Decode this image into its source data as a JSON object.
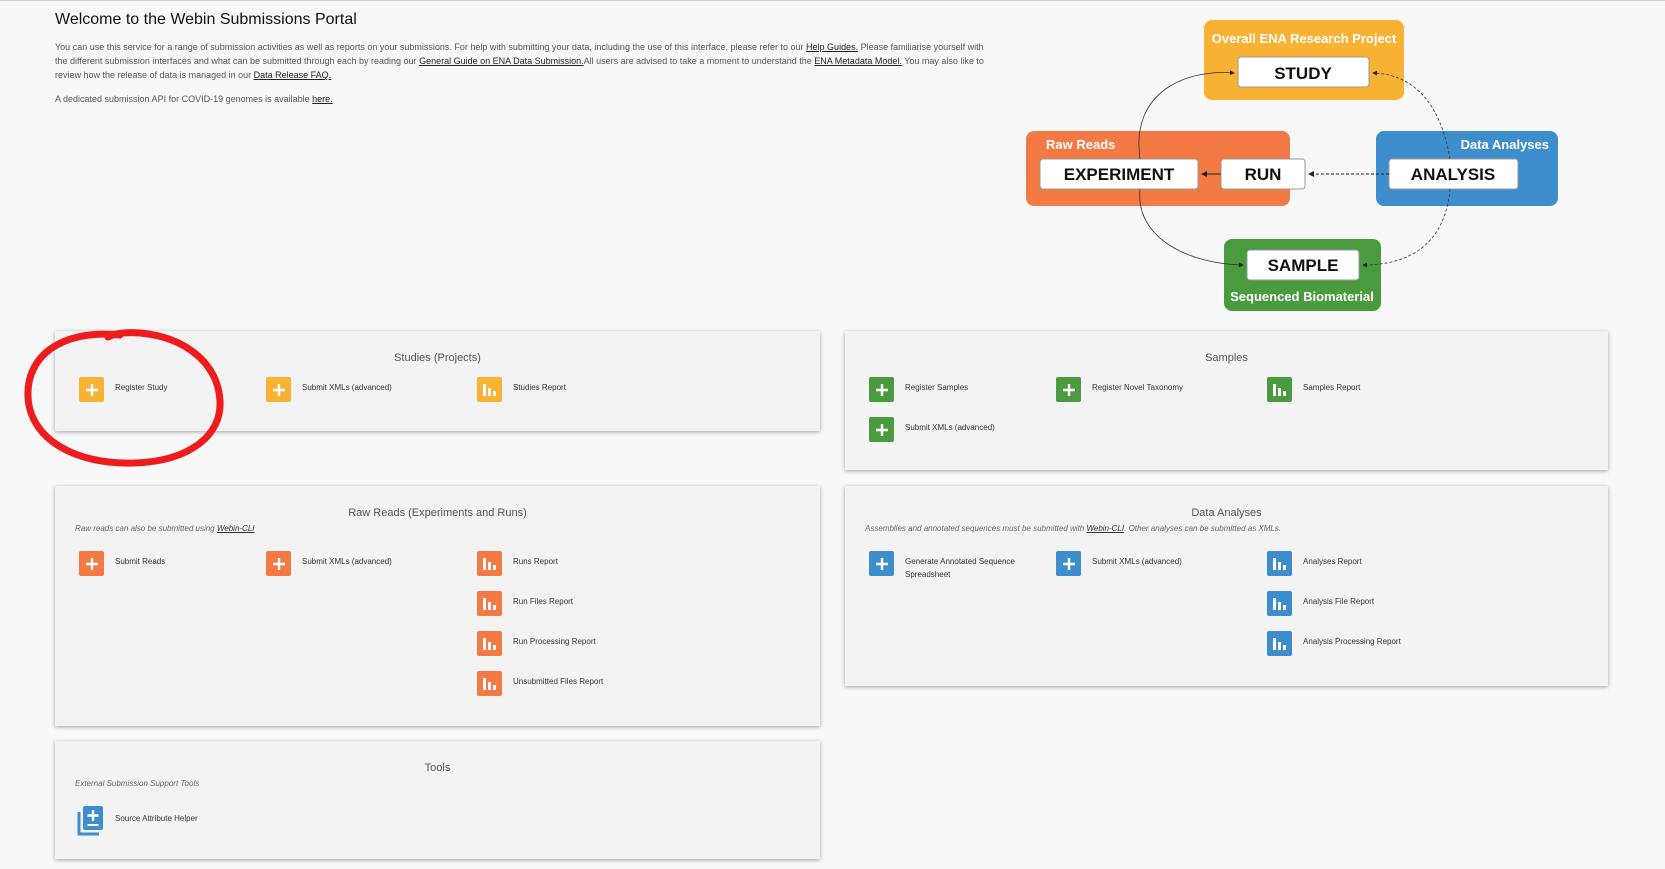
{
  "intro": {
    "title": "Welcome to the Webin Submissions Portal",
    "p1_part1": "You can use this service for a range of submission activities as well as reports on your submissions. For help with submitting your data, including the use of this interface, please refer to our ",
    "help_link": "Help Guides.",
    "p1_part2": " Please familiarise yourself with the different submission interfaces and what can be submitted through each by reading our ",
    "guide_link": "General Guide on ENA Data Submission.",
    "p1_part3": "All users are advised to take a moment to understand the ",
    "metadata_link": "ENA Metadata Model.",
    "p1_part4": " You may also like to review how the release of data is managed in our ",
    "faq_link": "Data Release FAQ.",
    "covid_text": "A dedicated submission API for COVID-19 genomes is available ",
    "covid_link": "here."
  },
  "diagram": {
    "project_title": "Overall ENA Research Project",
    "study": "STUDY",
    "raw_reads_title": "Raw Reads",
    "experiment": "EXPERIMENT",
    "run": "RUN",
    "analyses_title": "Data Analyses",
    "analysis": "ANALYSIS",
    "sample": "SAMPLE",
    "sample_title": "Sequenced Biomaterial",
    "colors": {
      "yellow": "#f9b233",
      "orange": "#f47a45",
      "blue": "#3e8ecd",
      "green": "#4a9b3f"
    }
  },
  "studies": {
    "title": "Studies (Projects)",
    "items": [
      "Register Study",
      "Submit XMLs (advanced)",
      "Studies Report"
    ]
  },
  "samples": {
    "title": "Samples",
    "items": [
      "Register Samples",
      "Register Novel Taxonomy",
      "Samples Report",
      "Submit XMLs (advanced)"
    ]
  },
  "raw_reads": {
    "title": "Raw Reads (Experiments and Runs)",
    "note": "Raw reads can also be submitted using ",
    "note_link": "Webin-CLI",
    "items": [
      "Submit Reads",
      "Submit XMLs (advanced)",
      "Runs Report",
      "Run Files Report",
      "Run Processing Report",
      "Unsubmitted Files Report"
    ]
  },
  "data_analyses": {
    "title": "Data Analyses",
    "note": "Assemblies and annotated sequences must be submitted with ",
    "note_link": "Webin-CLI",
    "note_tail": ". Other analyses can be submitted as XMLs.",
    "items": [
      "Generate Annotated Sequence Spreadsheet",
      "Submit XMLs (advanced)",
      "Analyses Report",
      "Analysis File Report",
      "Analysis Processing Report"
    ]
  },
  "tools": {
    "title": "Tools",
    "note": "External Submission Support Tools",
    "items": [
      "Source Attribute Helper"
    ]
  },
  "annotation": {
    "color": "#ee1c1c"
  }
}
